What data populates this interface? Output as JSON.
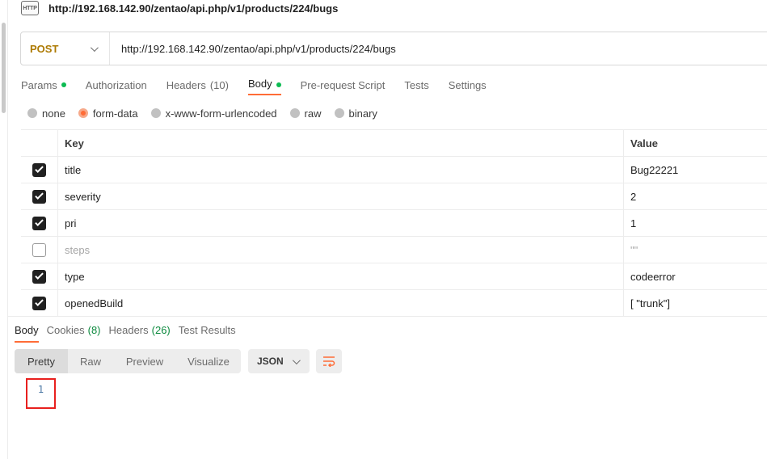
{
  "request": {
    "title": "http://192.168.142.90/zentao/api.php/v1/products/224/bugs",
    "method": "POST",
    "url": "http://192.168.142.90/zentao/api.php/v1/products/224/bugs",
    "icon_text": "HTTP"
  },
  "request_tabs": [
    {
      "label": "Params",
      "dot": true
    },
    {
      "label": "Authorization"
    },
    {
      "label": "Headers",
      "count": "(10)"
    },
    {
      "label": "Body",
      "dot": true,
      "active": true
    },
    {
      "label": "Pre-request Script"
    },
    {
      "label": "Tests"
    },
    {
      "label": "Settings"
    }
  ],
  "body_types": [
    {
      "label": "none",
      "selected": false
    },
    {
      "label": "form-data",
      "selected": true
    },
    {
      "label": "x-www-form-urlencoded",
      "selected": false
    },
    {
      "label": "raw",
      "selected": false
    },
    {
      "label": "binary",
      "selected": false
    }
  ],
  "params_table": {
    "headers": {
      "key": "Key",
      "value": "Value"
    },
    "rows": [
      {
        "checked": true,
        "key": "title",
        "value": "Bug22221"
      },
      {
        "checked": true,
        "key": "severity",
        "value": "2"
      },
      {
        "checked": true,
        "key": "pri",
        "value": "1"
      },
      {
        "checked": false,
        "key": "steps",
        "value": "\"\""
      },
      {
        "checked": true,
        "key": "type",
        "value": "codeerror"
      },
      {
        "checked": true,
        "key": "openedBuild",
        "value": "[ \"trunk\"]"
      }
    ]
  },
  "response_tabs": [
    {
      "label": "Body",
      "active": true
    },
    {
      "label": "Cookies",
      "count": "(8)"
    },
    {
      "label": "Headers",
      "count": "(26)"
    },
    {
      "label": "Test Results"
    }
  ],
  "view_modes": {
    "pretty": "Pretty",
    "raw": "Raw",
    "preview": "Preview",
    "visualize": "Visualize"
  },
  "format_select": "JSON",
  "editor": {
    "line_number": "1"
  },
  "colors": {
    "accent": "#ff6c37",
    "method": "#ad7a03",
    "dot": "#0cbb52",
    "count_green": "#0c8a3e",
    "highlight_box": "#e8201e"
  },
  "icons": {
    "http": "http-file-icon",
    "method_chevron": "chevron-down-icon",
    "format_chevron": "chevron-down-icon",
    "wrap": "wrap-lines-icon",
    "checkbox": "checkbox-icon"
  }
}
